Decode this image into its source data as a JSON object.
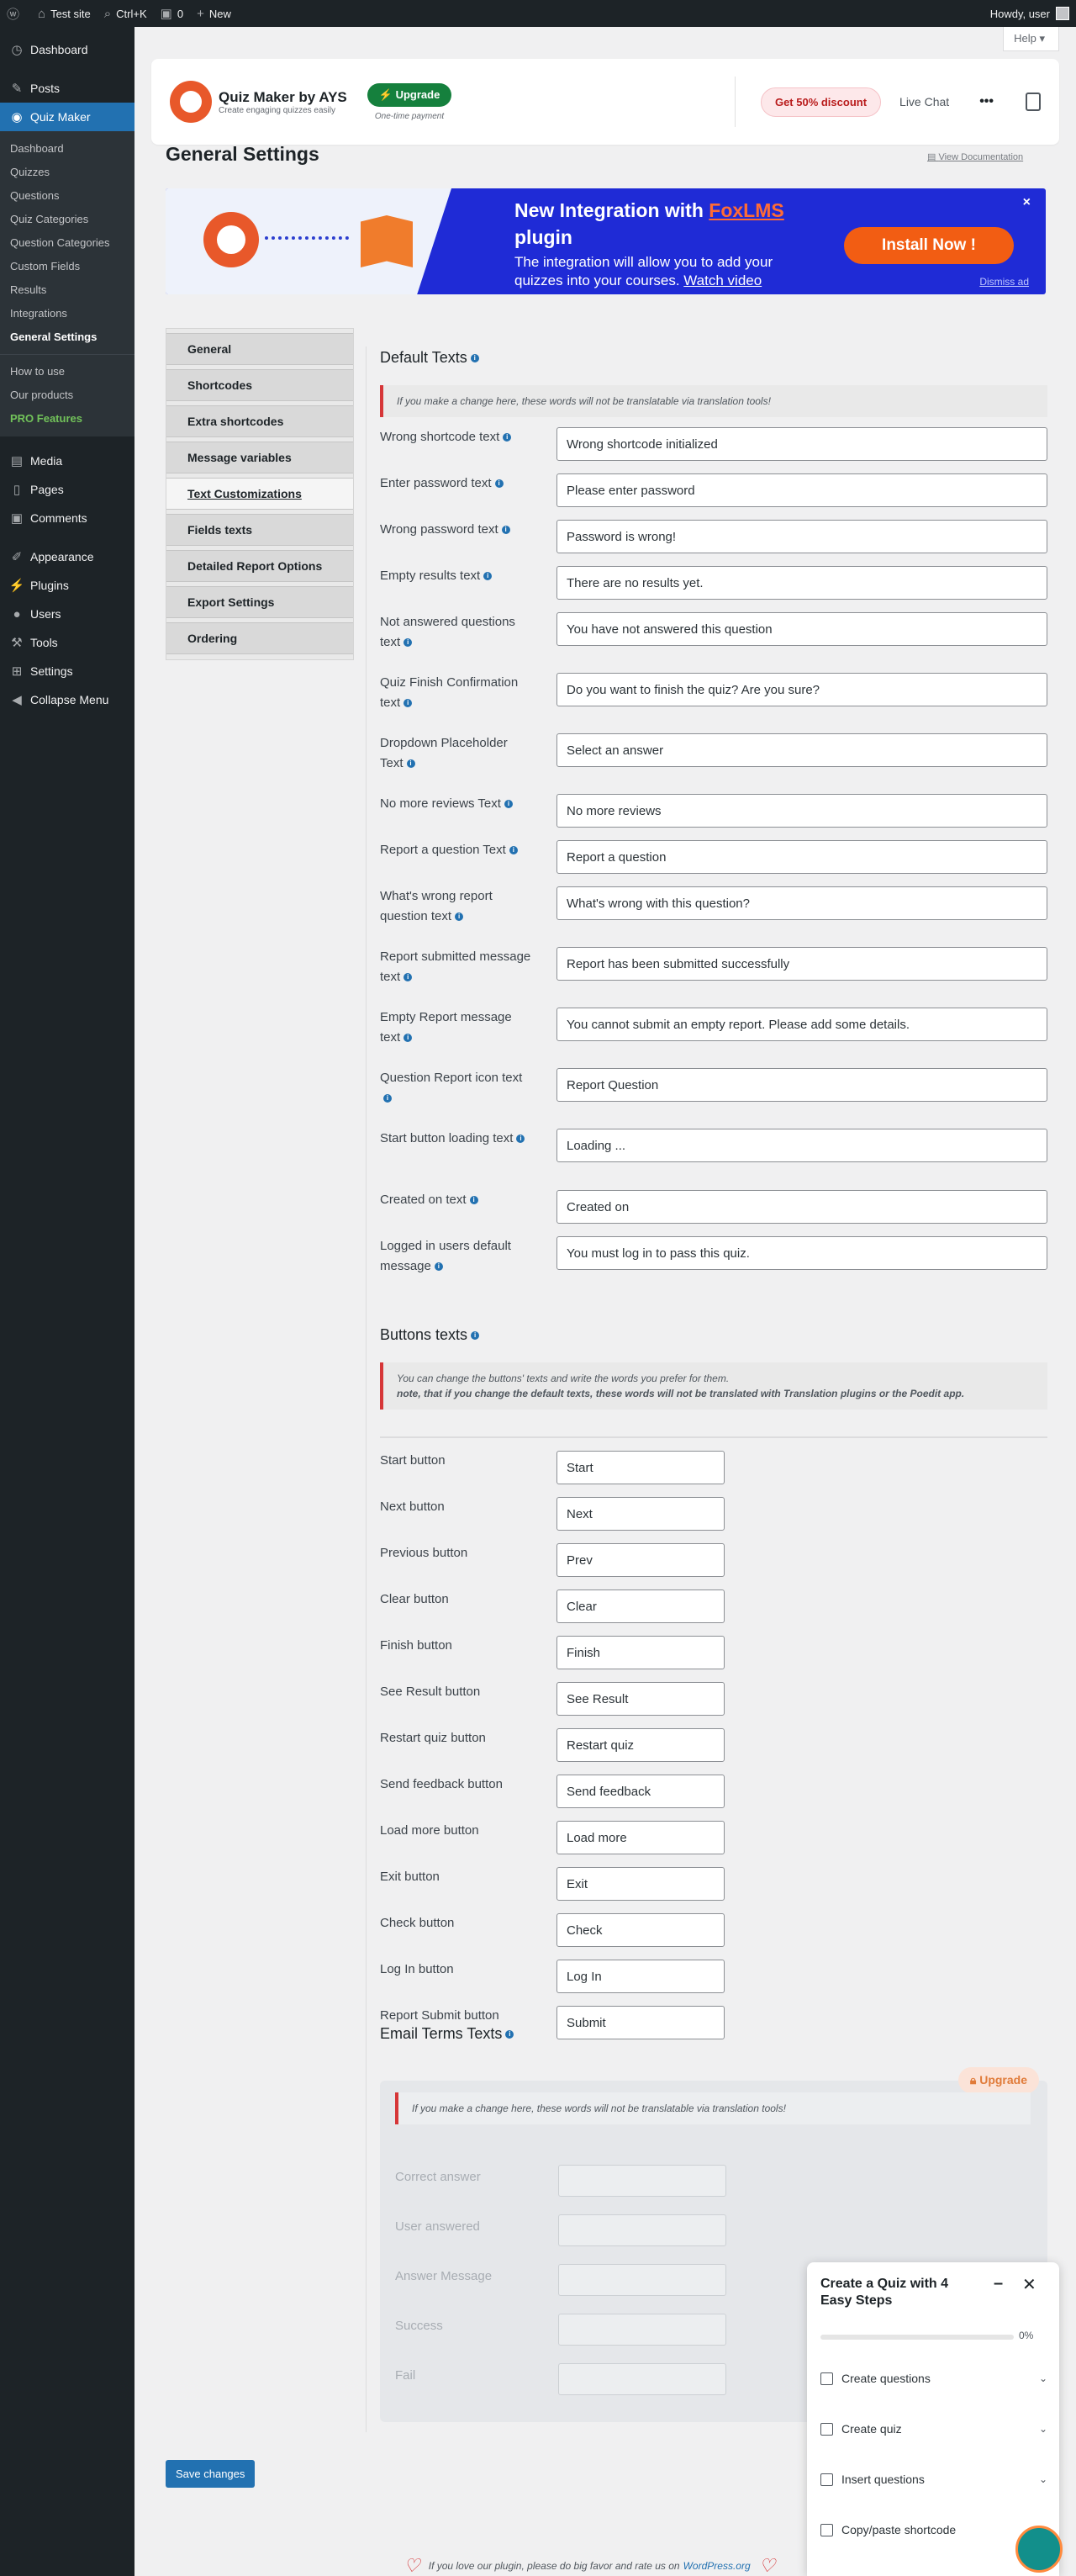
{
  "adminbar": {
    "site": "Test site",
    "search": "Ctrl+K",
    "comments": "0",
    "new": "New",
    "howdy": "Howdy, user"
  },
  "sidebar": {
    "dashboard": "Dashboard",
    "posts": "Posts",
    "quiz_maker": "Quiz Maker",
    "submenu": [
      "Dashboard",
      "Quizzes",
      "Questions",
      "Quiz Categories",
      "Question Categories",
      "Custom Fields",
      "Results",
      "Integrations",
      "General Settings"
    ],
    "submenu2": [
      "How to use",
      "Our products"
    ],
    "pro": "PRO Features",
    "media": "Media",
    "pages": "Pages",
    "comments": "Comments",
    "appearance": "Appearance",
    "plugins": "Plugins",
    "users": "Users",
    "tools": "Tools",
    "settings": "Settings",
    "collapse": "Collapse Menu"
  },
  "help": "Help ▾",
  "header": {
    "title": "Quiz Maker by AYS",
    "subtitle": "Create engaging quizzes easily",
    "upgrade": "Upgrade",
    "upgrade_note": "One-time payment",
    "discount": "Get 50% discount",
    "livechat": "Live Chat",
    "more": "•••"
  },
  "page": {
    "title": "General Settings",
    "view_docs": "View Documentation"
  },
  "banner": {
    "title_pre": "New Integration with ",
    "title_link": "FoxLMS",
    "title_post": " plugin",
    "desc_pre": "The integration will allow you to add your quizzes into your courses. ",
    "desc_link": "Watch video",
    "install": "Install Now !",
    "close": "×",
    "dismiss": "Dismiss ad"
  },
  "tabs": [
    "General",
    "Shortcodes",
    "Extra shortcodes",
    "Message variables",
    "Text Customizations",
    "Fields texts",
    "Detailed Report Options",
    "Export Settings",
    "Ordering"
  ],
  "default_texts": {
    "heading": "Default Texts",
    "notice": "If you make a change here, these words will not be translatable via translation tools!",
    "rows": [
      {
        "label": "Wrong shortcode text",
        "value": "Wrong shortcode initialized"
      },
      {
        "label": "Enter password text",
        "value": "Please enter password"
      },
      {
        "label": "Wrong password text",
        "value": "Password is wrong!"
      },
      {
        "label": "Empty results text",
        "value": "There are no results yet."
      },
      {
        "label": "Not answered questions text",
        "value": "You have not answered this question"
      },
      {
        "label": "Quiz Finish Confirmation text",
        "value": "Do you want to finish the quiz? Are you sure?"
      },
      {
        "label": "Dropdown Placeholder Text",
        "value": "Select an answer"
      },
      {
        "label": "No more reviews Text",
        "value": "No more reviews"
      },
      {
        "label": "Report a question Text",
        "value": "Report a question"
      },
      {
        "label": "What's wrong report question text",
        "value": "What's wrong with this question?"
      },
      {
        "label": "Report submitted message text",
        "value": "Report has been submitted successfully"
      },
      {
        "label": "Empty Report message text",
        "value": "You cannot submit an empty report. Please add some details."
      },
      {
        "label": "Question Report icon text",
        "value": "Report Question"
      },
      {
        "label": "Start button loading text",
        "value": "Loading ..."
      },
      {
        "label": "Created on text",
        "value": "Created on"
      },
      {
        "label": "Logged in users default message",
        "value": "You must log in to pass this quiz."
      }
    ]
  },
  "buttons_texts": {
    "heading": "Buttons texts",
    "notice_line1": "You can change the buttons' texts and write the words you prefer for them.",
    "notice_line2": "note, that if you change the default texts, these words will not be translated with Translation plugins or the Poedit app.",
    "rows": [
      {
        "label": "Start button",
        "value": "Start"
      },
      {
        "label": "Next button",
        "value": "Next"
      },
      {
        "label": "Previous button",
        "value": "Prev"
      },
      {
        "label": "Clear button",
        "value": "Clear"
      },
      {
        "label": "Finish button",
        "value": "Finish"
      },
      {
        "label": "See Result button",
        "value": "See Result"
      },
      {
        "label": "Restart quiz button",
        "value": "Restart quiz"
      },
      {
        "label": "Send feedback button",
        "value": "Send feedback"
      },
      {
        "label": "Load more button",
        "value": "Load more"
      },
      {
        "label": "Exit button",
        "value": "Exit"
      },
      {
        "label": "Check button",
        "value": "Check"
      },
      {
        "label": "Log In button",
        "value": "Log In"
      },
      {
        "label": "Report Submit button",
        "value": "Submit"
      }
    ]
  },
  "email_terms": {
    "heading": "Email Terms Texts",
    "upgrade": "Upgrade",
    "notice": "If you make a change here, these words will not be translatable via translation tools!",
    "rows": [
      "Correct answer",
      "User answered",
      "Answer Message",
      "Success",
      "Fail"
    ]
  },
  "save": "Save changes",
  "footer": {
    "text": "If you love our plugin, please do big favor and rate us on",
    "link": "WordPress.org"
  },
  "steps_widget": {
    "title": "Create a Quiz with 4 Easy Steps",
    "percent": "0%",
    "progress": 0,
    "steps": [
      "Create questions",
      "Create quiz",
      "Insert questions",
      "Copy/paste shortcode"
    ]
  }
}
